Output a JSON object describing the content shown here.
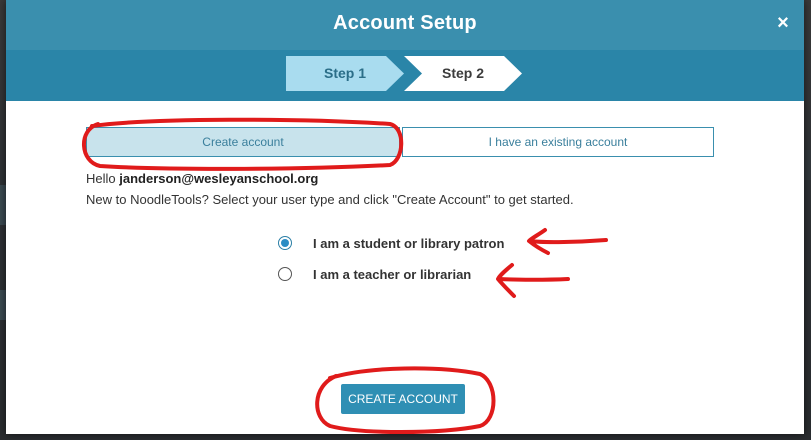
{
  "modal": {
    "title": "Account Setup",
    "close_glyph": "×",
    "close_icon": "close-icon"
  },
  "stepper": {
    "steps": [
      {
        "label": "Step 1",
        "active": true,
        "color": "#a9dcef"
      },
      {
        "label": "Step 2",
        "active": false,
        "color": "#ffffff"
      }
    ]
  },
  "tabs": [
    {
      "label": "Create account",
      "selected": true
    },
    {
      "label": "I have an existing account",
      "selected": false
    }
  ],
  "greeting": {
    "prefix": "Hello ",
    "email": "janderson@wesleyanschool.org",
    "intro": "New to NoodleTools? Select your user type and click \"Create Account\" to get started."
  },
  "user_types": [
    {
      "label": "I am a student or library patron",
      "checked": true
    },
    {
      "label": "I am a teacher or librarian",
      "checked": false
    }
  ],
  "actions": {
    "create_account_label": "CREATE ACCOUNT"
  },
  "colors": {
    "header": "#3a8fae",
    "stepper_bar": "#2a85a8",
    "accent": "#2f8fb4",
    "annotation": "#e01b1b"
  }
}
